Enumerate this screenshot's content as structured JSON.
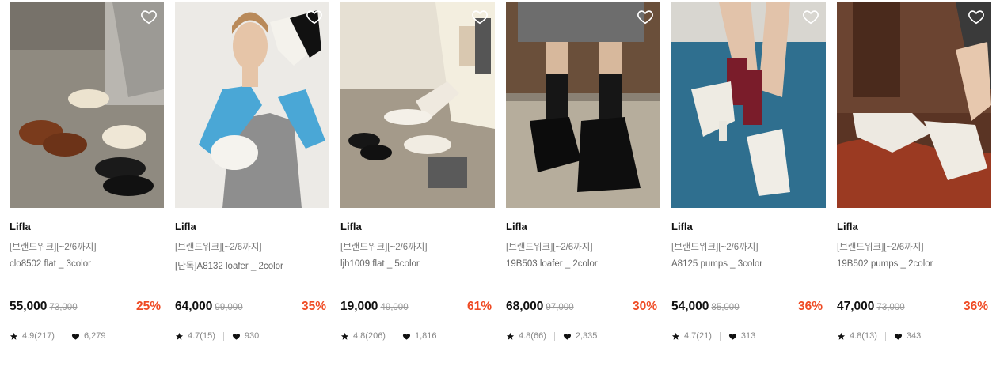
{
  "products": [
    {
      "brand": "Lifla",
      "promo": "[브랜드위크][~2/6까지]",
      "name": "clo8502 flat _ 3color",
      "price": "55,000",
      "original_price": "73,000",
      "discount": "25%",
      "rating": "4.9(217)",
      "likes": "6,279"
    },
    {
      "brand": "Lifla",
      "promo": "[브랜드위크][~2/6까지]",
      "name": "[단독]A8132 loafer _ 2color",
      "price": "64,000",
      "original_price": "99,000",
      "discount": "35%",
      "rating": "4.7(15)",
      "likes": "930"
    },
    {
      "brand": "Lifla",
      "promo": "[브랜드위크][~2/6까지]",
      "name": "ljh1009 flat _ 5color",
      "price": "19,000",
      "original_price": "49,000",
      "discount": "61%",
      "rating": "4.8(206)",
      "likes": "1,816"
    },
    {
      "brand": "Lifla",
      "promo": "[브랜드위크][~2/6까지]",
      "name": "19B503 loafer _ 2color",
      "price": "68,000",
      "original_price": "97,000",
      "discount": "30%",
      "rating": "4.8(66)",
      "likes": "2,335"
    },
    {
      "brand": "Lifla",
      "promo": "[브랜드위크][~2/6까지]",
      "name": "A8125 pumps _ 3color",
      "price": "54,000",
      "original_price": "85,000",
      "discount": "36%",
      "rating": "4.7(21)",
      "likes": "313"
    },
    {
      "brand": "Lifla",
      "promo": "[브랜드위크][~2/6까지]",
      "name": "19B502 pumps _ 2color",
      "price": "47,000",
      "original_price": "73,000",
      "discount": "36%",
      "rating": "4.8(13)",
      "likes": "343"
    }
  ],
  "colors": {
    "discount": "#ef4a23",
    "price": "#111111",
    "meta": "#888888"
  },
  "icons": {
    "wishlist": "heart-outline-icon",
    "rating": "star-icon",
    "likes": "heart-filled-icon"
  }
}
